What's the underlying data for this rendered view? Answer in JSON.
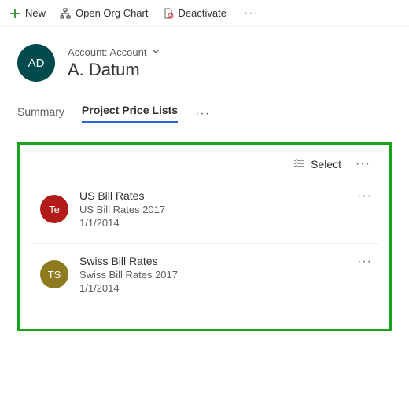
{
  "toolbar": {
    "new_label": "New",
    "open_org_chart_label": "Open Org Chart",
    "deactivate_label": "Deactivate"
  },
  "record": {
    "avatar_initials": "AD",
    "entity_label": "Account: Account",
    "name": "A. Datum"
  },
  "tabs": {
    "summary": "Summary",
    "project_price_lists": "Project Price Lists"
  },
  "subgrid": {
    "select_label": "Select",
    "items": [
      {
        "initials": "Te",
        "title": "US Bill Rates",
        "subtitle": "US Bill Rates 2017",
        "date": "1/1/2014"
      },
      {
        "initials": "TS",
        "title": "Swiss Bill Rates",
        "subtitle": "Swiss Bill Rates 2017",
        "date": "1/1/2014"
      }
    ]
  }
}
